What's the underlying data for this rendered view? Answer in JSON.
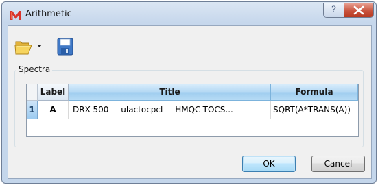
{
  "window": {
    "title": "Arithmetic"
  },
  "titlebar": {
    "help_glyph": "?",
    "close_glyph": "x"
  },
  "toolbar": {
    "open_icon": "folder-open-icon",
    "save_icon": "floppy-save-icon"
  },
  "spectra": {
    "group_label": "Spectra",
    "columns": [
      "Label",
      "Title",
      "Formula"
    ],
    "rows": [
      {
        "num": "1",
        "label": "A",
        "title_parts": [
          "DRX-500",
          "ulactocpcl",
          "HMQC-TOCS..."
        ],
        "formula": "SQRT(A*TRANS(A))"
      }
    ]
  },
  "buttons": {
    "ok": "OK",
    "cancel": "Cancel"
  },
  "colors": {
    "accent": "#9fcdef",
    "brand_icon": "#d9342b"
  }
}
